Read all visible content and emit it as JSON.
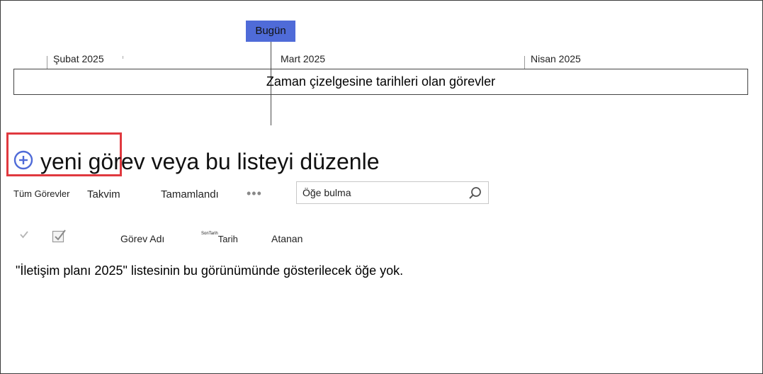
{
  "timeline": {
    "today_label": "Bugün",
    "months": [
      "Şubat 2025",
      "Mart 2025",
      "Nisan 2025"
    ],
    "box_text": "Zaman çizelgesine tarihleri olan görevler"
  },
  "new_task": {
    "label": "yeni görev veya bu listeyi düzenle"
  },
  "views": {
    "tabs": [
      "Tüm Görevler",
      "Takvim",
      "Tamamlandı"
    ],
    "more": "•••"
  },
  "search": {
    "placeholder": "Öğe bulma"
  },
  "columns": {
    "task_name": "Görev Adı",
    "due_date_sup": "SonTarih",
    "due_date": "Tarih",
    "assigned": "Atanan"
  },
  "empty_message": "\"İletişim planı 2025\" listesinin bu görünümünde gösterilecek öğe yok.",
  "colors": {
    "today": "#4f6bd8",
    "highlight": "#e0393f",
    "plus_icon": "#4f6bd8"
  }
}
